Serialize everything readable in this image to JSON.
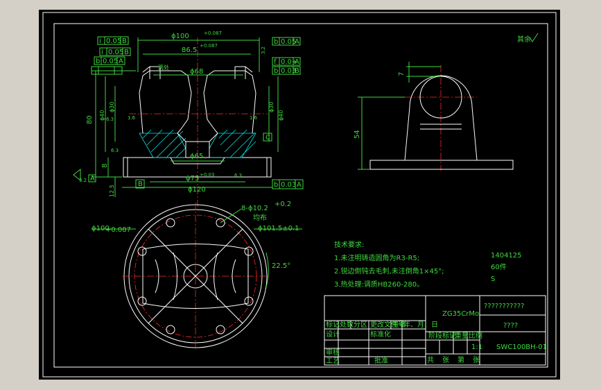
{
  "left_view": {
    "dims": {
      "dia100_top": "ϕ100",
      "dia100_tol": "+0.087",
      "dia86": "86.5",
      "dia86_tol": "+0.087",
      "dia68": "ϕ68",
      "dia65": "ϕ65",
      "dia75": "ϕ75",
      "dia75_tol": "+0.03",
      "dia120": "ϕ120",
      "h80": "80",
      "h8": "8",
      "h12_5": "12.5",
      "dia40_l": "ϕ40",
      "dia30_l": "ϕ30",
      "dia40_r": "ϕ40",
      "dia30_r": "ϕ30",
      "r6_3a": "6.3",
      "r1_6a": "1.6",
      "r1_6b": "1.6",
      "r6_3b": "6.3",
      "r6_3c": "6.3",
      "r3_2a": "3.2",
      "r3_2b": "3.2",
      "side_note": "两处"
    },
    "tol_boxes": [
      {
        "sym": "i",
        "val": "0.05",
        "ref": "B"
      },
      {
        "sym": "i",
        "val": "0.05",
        "ref": "B"
      },
      {
        "sym": "b",
        "val": "0.05",
        "ref": "A"
      },
      {
        "sym": "b",
        "val": "0.05",
        "ref": "A"
      },
      {
        "sym": "f",
        "val": "0.0+",
        "ref": "A"
      },
      {
        "sym": "b",
        "val": "0.03",
        "ref": "B"
      },
      {
        "sym": "b",
        "val": "0.03",
        "ref": "A"
      }
    ],
    "datums": {
      "a": "A",
      "b": "B",
      "c": "C"
    }
  },
  "right_view": {
    "dim7": "7",
    "dim54": "54"
  },
  "bottom_view": {
    "holes": "8-ϕ10.2",
    "holes_tol": "+0.2",
    "holes_note": "均布",
    "dia100": "ϕ100",
    "dia100_tol": "+0.087",
    "dia101": "ϕ101.5±0.1",
    "angle": "22.5°"
  },
  "tech": {
    "title": "技术要求:",
    "line1": "1.未注明铸造圆角为R3-R5;",
    "line2": "2.锐边倒钝去毛刺,未注倒角1×45°;",
    "line3": "3.热处理:调质HB260-280。"
  },
  "right_notes": {
    "num": "1404125",
    "qty": "60件",
    "code": "S"
  },
  "title_block": {
    "material": "ZG35CrMo",
    "name": "???????????",
    "company": "????",
    "drawing_no": "SWC100BH-01",
    "scale": "1:1",
    "row_labels": [
      "标记",
      "处数",
      "分区",
      "更改文件号",
      "签名",
      "年、月、日"
    ],
    "designer": "设计",
    "standard": "标准化",
    "review": "审核",
    "process": "工艺",
    "approve": "批准",
    "stage": "阶段标记",
    "weight": "重量",
    "ratio": "比例",
    "sheets": [
      "共",
      "张",
      "第",
      "张"
    ]
  },
  "roughness_mark": "其余"
}
